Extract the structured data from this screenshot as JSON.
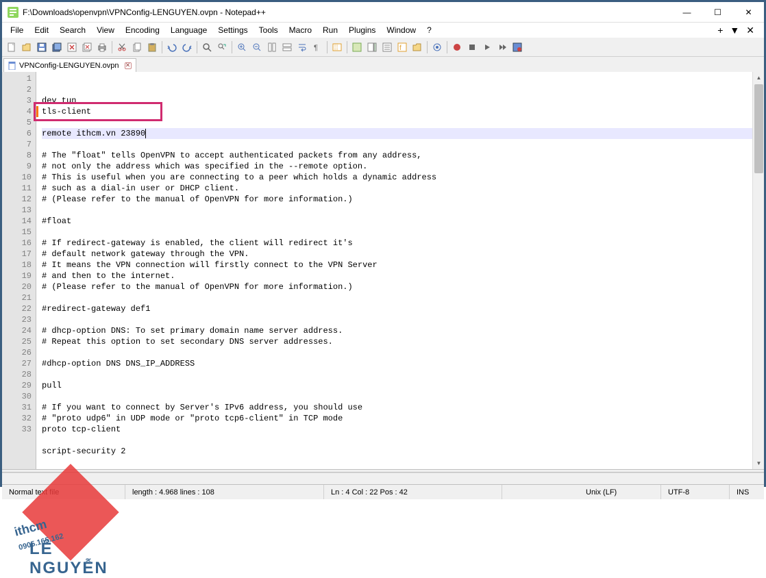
{
  "window": {
    "title": "F:\\Downloads\\openvpn\\VPNConfig-LENGUYEN.ovpn - Notepad++",
    "min": "—",
    "max": "☐",
    "close": "✕"
  },
  "menu": {
    "items": [
      "File",
      "Edit",
      "Search",
      "View",
      "Encoding",
      "Language",
      "Settings",
      "Tools",
      "Macro",
      "Run",
      "Plugins",
      "Window",
      "?"
    ],
    "right": [
      "+",
      "▼",
      "✕"
    ]
  },
  "tab": {
    "name": "VPNConfig-LENGUYEN.ovpn"
  },
  "code": {
    "lines": [
      "dev tun",
      "tls-client",
      "",
      "remote ithcm.vn 23890",
      "",
      "# The \"float\" tells OpenVPN to accept authenticated packets from any address,",
      "# not only the address which was specified in the --remote option.",
      "# This is useful when you are connecting to a peer which holds a dynamic address",
      "# such as a dial-in user or DHCP client.",
      "# (Please refer to the manual of OpenVPN for more information.)",
      "",
      "#float",
      "",
      "# If redirect-gateway is enabled, the client will redirect it's",
      "# default network gateway through the VPN.",
      "# It means the VPN connection will firstly connect to the VPN Server",
      "# and then to the internet.",
      "# (Please refer to the manual of OpenVPN for more information.)",
      "",
      "#redirect-gateway def1",
      "",
      "# dhcp-option DNS: To set primary domain name server address.",
      "# Repeat this option to set secondary DNS server addresses.",
      "",
      "#dhcp-option DNS DNS_IP_ADDRESS",
      "",
      "pull",
      "",
      "# If you want to connect by Server's IPv6 address, you should use",
      "# \"proto udp6\" in UDP mode or \"proto tcp6-client\" in TCP mode",
      "proto tcp-client",
      "",
      "script-security 2"
    ],
    "current_line_index": 3
  },
  "status": {
    "filetype": "Normal text file",
    "length": "length : 4.968    lines : 108",
    "position": "Ln : 4    Col : 22    Pos : 42",
    "eol": "Unix (LF)",
    "encoding": "UTF-8",
    "mode": "INS"
  },
  "watermark": {
    "brand": "ithcm",
    "phone": "0905.165.162",
    "name": "LÊ NGUYỄN"
  }
}
